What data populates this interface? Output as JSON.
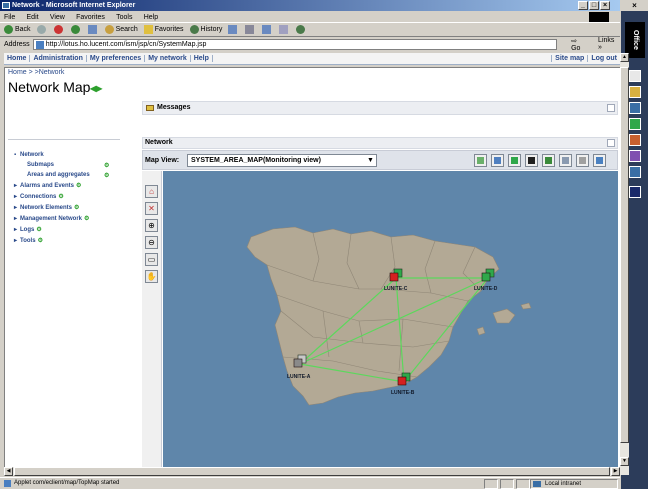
{
  "window": {
    "title": "Network - Microsoft Internet Explorer",
    "menu": [
      "File",
      "Edit",
      "View",
      "Favorites",
      "Tools",
      "Help"
    ]
  },
  "toolbar": {
    "back": "Back",
    "search": "Search",
    "favorites": "Favorites",
    "history": "History"
  },
  "address": {
    "label": "Address",
    "url": "http://lotus.ho.lucent.com/ism/jsp/cn/SystemMap.jsp",
    "go": "Go",
    "links": "Links"
  },
  "office_bar": {
    "title": "Office"
  },
  "app_nav": {
    "left": [
      "Home",
      "Administration",
      "My preferences",
      "My network",
      "Help"
    ],
    "right": [
      "Site map",
      "Log out"
    ]
  },
  "breadcrumb": "Home > >Network",
  "page_title": "Network Map",
  "messages_panel": {
    "title": "Messages"
  },
  "network_panel": {
    "title": "Network"
  },
  "map_view": {
    "label": "Map View:",
    "selected": "SYSTEM_AREA_MAP(Monitoring view)"
  },
  "tree": [
    {
      "label": "Network",
      "children": [
        "Submaps",
        "Areas and aggregates"
      ]
    },
    {
      "label": "Alarms and Events"
    },
    {
      "label": "Connections"
    },
    {
      "label": "Network Elements"
    },
    {
      "label": "Management Network"
    },
    {
      "label": "Logs"
    },
    {
      "label": "Tools"
    }
  ],
  "map": {
    "sea_color": "#5f86aa",
    "land_color": "#b3a995",
    "link_color": "#5cd85c",
    "nodes": [
      {
        "id": "LUNITE-C",
        "label": "LUNITE-C",
        "status": "critical",
        "color": "#d42020"
      },
      {
        "id": "LUNITE-D",
        "label": "LUNITE-D",
        "status": "normal",
        "color": "#2fa84a"
      },
      {
        "id": "LUNITE-A",
        "label": "LUNITE-A",
        "status": "unmanaged",
        "color": "#8a8a8a"
      },
      {
        "id": "LUNITE-B",
        "label": "LUNITE-B",
        "status": "critical",
        "color": "#d42020"
      }
    ]
  },
  "status": {
    "message": "Applet com/eclient/map/TopMap started",
    "zone": "Local intranet"
  }
}
